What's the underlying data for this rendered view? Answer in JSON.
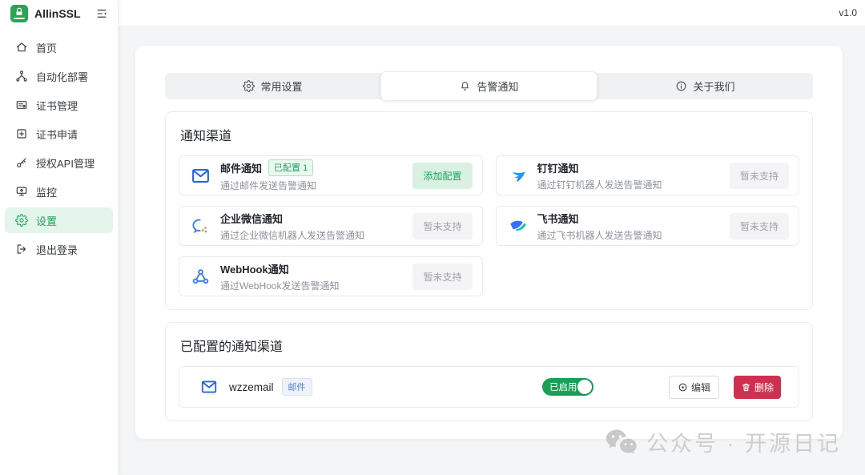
{
  "app": {
    "name": "AllinSSL",
    "version": "v1.0"
  },
  "sidebar": {
    "items": [
      {
        "key": "home",
        "label": "首页",
        "icon": "home-icon"
      },
      {
        "key": "auto-deploy",
        "label": "自动化部署",
        "icon": "deploy-icon"
      },
      {
        "key": "cert-manage",
        "label": "证书管理",
        "icon": "cert-manage-icon"
      },
      {
        "key": "cert-apply",
        "label": "证书申请",
        "icon": "cert-apply-icon"
      },
      {
        "key": "api-auth",
        "label": "授权API管理",
        "icon": "key-icon"
      },
      {
        "key": "monitor",
        "label": "监控",
        "icon": "monitor-icon"
      },
      {
        "key": "settings",
        "label": "设置",
        "icon": "gear-icon",
        "active": true
      },
      {
        "key": "logout",
        "label": "退出登录",
        "icon": "logout-icon"
      }
    ]
  },
  "tabs": [
    {
      "key": "general",
      "label": "常用设置",
      "icon": "gear-icon"
    },
    {
      "key": "alerts",
      "label": "告警通知",
      "icon": "bell-icon",
      "active": true
    },
    {
      "key": "about",
      "label": "关于我们",
      "icon": "info-icon"
    }
  ],
  "channels_section": {
    "title": "通知渠道",
    "channels": [
      {
        "key": "email",
        "name": "邮件通知",
        "badge": "已配置 1",
        "desc": "通过邮件发送告警通知",
        "action": "添加配置",
        "action_type": "primary",
        "icon": "email-icon"
      },
      {
        "key": "dingtalk",
        "name": "钉钉通知",
        "desc": "通过钉钉机器人发送告警通知",
        "action": "暂未支持",
        "action_type": "disabled",
        "icon": "dingtalk-icon"
      },
      {
        "key": "wecom",
        "name": "企业微信通知",
        "desc": "通过企业微信机器人发送告警通知",
        "action": "暂未支持",
        "action_type": "disabled",
        "icon": "wecom-icon"
      },
      {
        "key": "feishu",
        "name": "飞书通知",
        "desc": "通过飞书机器人发送告警通知",
        "action": "暂未支持",
        "action_type": "disabled",
        "icon": "feishu-icon"
      },
      {
        "key": "webhook",
        "name": "WebHook通知",
        "desc": "通过WebHook发送告警通知",
        "action": "暂未支持",
        "action_type": "disabled",
        "icon": "webhook-icon"
      }
    ]
  },
  "configured_section": {
    "title": "已配置的通知渠道",
    "rows": [
      {
        "key": "wzzemail",
        "name": "wzzemail",
        "type_badge": "邮件",
        "icon": "email-icon",
        "status_label": "已启用",
        "enabled": true,
        "edit_label": "编辑",
        "delete_label": "删除"
      }
    ]
  },
  "watermark": {
    "text": "公众号 · 开源日记",
    "icon": "wechat-icon"
  },
  "colors": {
    "brand_green": "#18a058",
    "active_nav_bg": "#e4f5eb",
    "light_green_button_bg": "#d9f1e3",
    "danger_red": "#cf3050",
    "email_blue": "#2563eb",
    "disabled_text": "#9ea3ab",
    "page_bg": "#f4f5f7"
  }
}
